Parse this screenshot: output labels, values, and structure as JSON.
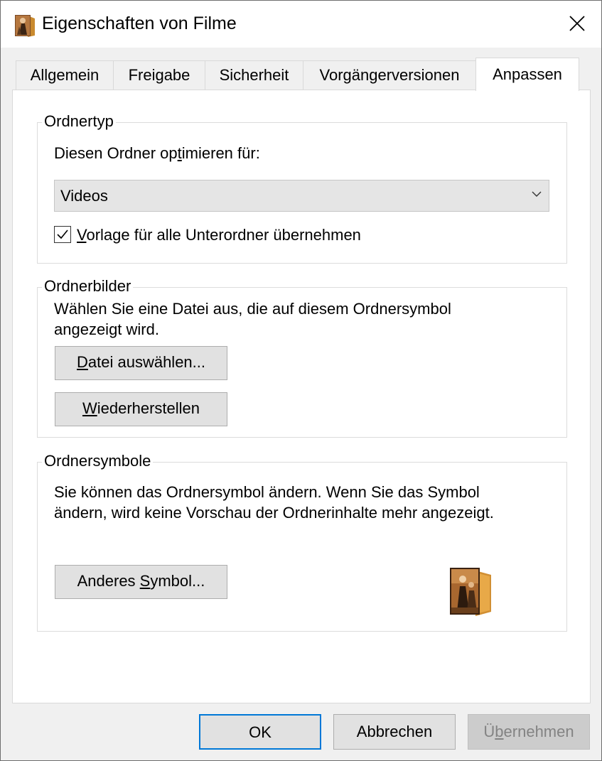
{
  "window": {
    "title": "Eigenschaften von Filme",
    "app_icon": "folder-movie-icon",
    "close_icon": "close-icon"
  },
  "tabs": [
    {
      "label": "Allgemein",
      "active": false
    },
    {
      "label": "Freigabe",
      "active": false
    },
    {
      "label": "Sicherheit",
      "active": false
    },
    {
      "label": "Vorgängerversionen",
      "active": false
    },
    {
      "label": "Anpassen",
      "active": true
    }
  ],
  "ordnertyp": {
    "legend": "Ordnertyp",
    "optimize_label_pre": "Diesen Ordner op",
    "optimize_label_mn": "t",
    "optimize_label_post": "imieren für:",
    "select_value": "Videos",
    "checkbox_checked": true,
    "checkbox_label_mn": "V",
    "checkbox_label_rest": "orlage für alle Unterordner übernehmen"
  },
  "ordnerbilder": {
    "legend": "Ordnerbilder",
    "description_line1": "Wählen Sie eine Datei aus, die auf diesem Ordnersymbol",
    "description_line2": "angezeigt wird.",
    "choose_file_mn": "D",
    "choose_file_rest": "atei auswählen...",
    "restore_mn": "W",
    "restore_rest": "iederherstellen"
  },
  "ordnersymbole": {
    "legend": "Ordnersymbole",
    "description_line1": "Sie können das Ordnersymbol ändern. Wenn Sie das Symbol",
    "description_line2": "ändern, wird keine Vorschau der Ordnerinhalte mehr angezeigt.",
    "change_icon_pre": "Anderes ",
    "change_icon_mn": "S",
    "change_icon_post": "ymbol...",
    "preview_icon": "folder-movie-icon"
  },
  "buttons": {
    "ok": "OK",
    "cancel": "Abbrechen",
    "apply_pre": "Ü",
    "apply_mn": "b",
    "apply_post": "ernehmen",
    "apply_enabled": false
  },
  "colors": {
    "dialog_bg": "#f0f0f0",
    "accent_border": "#0078d7",
    "disabled_text": "#838383"
  }
}
